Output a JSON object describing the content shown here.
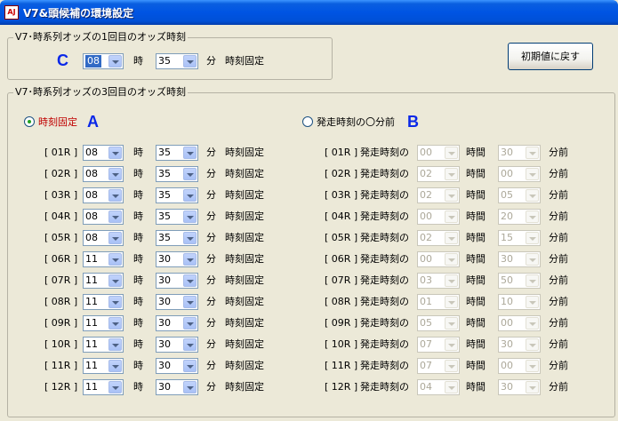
{
  "window": {
    "title": "V7&頭候補の環境設定",
    "icon_text": "AJ"
  },
  "first_odds": {
    "group_title": "V7･時系列オッズの1回目のオッズ時刻",
    "marker": "C",
    "hour": "08",
    "hour_unit": "時",
    "minute": "35",
    "minute_unit": "分",
    "suffix": "時刻固定"
  },
  "reset_button": "初期値に戻す",
  "third_odds": {
    "group_title": "V7･時系列オッズの3回目のオッズ時刻",
    "option_a": {
      "label": "時刻固定",
      "marker": "A",
      "selected": true
    },
    "option_b": {
      "label": "発走時刻の〇分前",
      "marker": "B",
      "selected": false
    },
    "hour_unit": "時",
    "minute_unit": "分",
    "fixed_suffix": "時刻固定",
    "rel_prefix": "発走時刻の",
    "rel_hour_unit": "時間",
    "rel_minute_unit": "分前",
    "races": [
      {
        "race": "[ 01R ]",
        "hour": "08",
        "minute": "35",
        "rel_hour": "00",
        "rel_minute": "30"
      },
      {
        "race": "[ 02R ]",
        "hour": "08",
        "minute": "35",
        "rel_hour": "02",
        "rel_minute": "00"
      },
      {
        "race": "[ 03R ]",
        "hour": "08",
        "minute": "35",
        "rel_hour": "02",
        "rel_minute": "05"
      },
      {
        "race": "[ 04R ]",
        "hour": "08",
        "minute": "35",
        "rel_hour": "00",
        "rel_minute": "20"
      },
      {
        "race": "[ 05R ]",
        "hour": "08",
        "minute": "35",
        "rel_hour": "02",
        "rel_minute": "15"
      },
      {
        "race": "[ 06R ]",
        "hour": "11",
        "minute": "30",
        "rel_hour": "00",
        "rel_minute": "30"
      },
      {
        "race": "[ 07R ]",
        "hour": "11",
        "minute": "30",
        "rel_hour": "03",
        "rel_minute": "50"
      },
      {
        "race": "[ 08R ]",
        "hour": "11",
        "minute": "30",
        "rel_hour": "01",
        "rel_minute": "10"
      },
      {
        "race": "[ 09R ]",
        "hour": "11",
        "minute": "30",
        "rel_hour": "05",
        "rel_minute": "00"
      },
      {
        "race": "[ 10R ]",
        "hour": "11",
        "minute": "30",
        "rel_hour": "07",
        "rel_minute": "30"
      },
      {
        "race": "[ 11R ]",
        "hour": "11",
        "minute": "30",
        "rel_hour": "07",
        "rel_minute": "00"
      },
      {
        "race": "[ 12R ]",
        "hour": "11",
        "minute": "30",
        "rel_hour": "04",
        "rel_minute": "30"
      }
    ]
  },
  "colors": {
    "title_bar": "#0054e3",
    "marker": "#0a28e8",
    "selected_label": "#c00000",
    "window_bg": "#ece9d8"
  }
}
